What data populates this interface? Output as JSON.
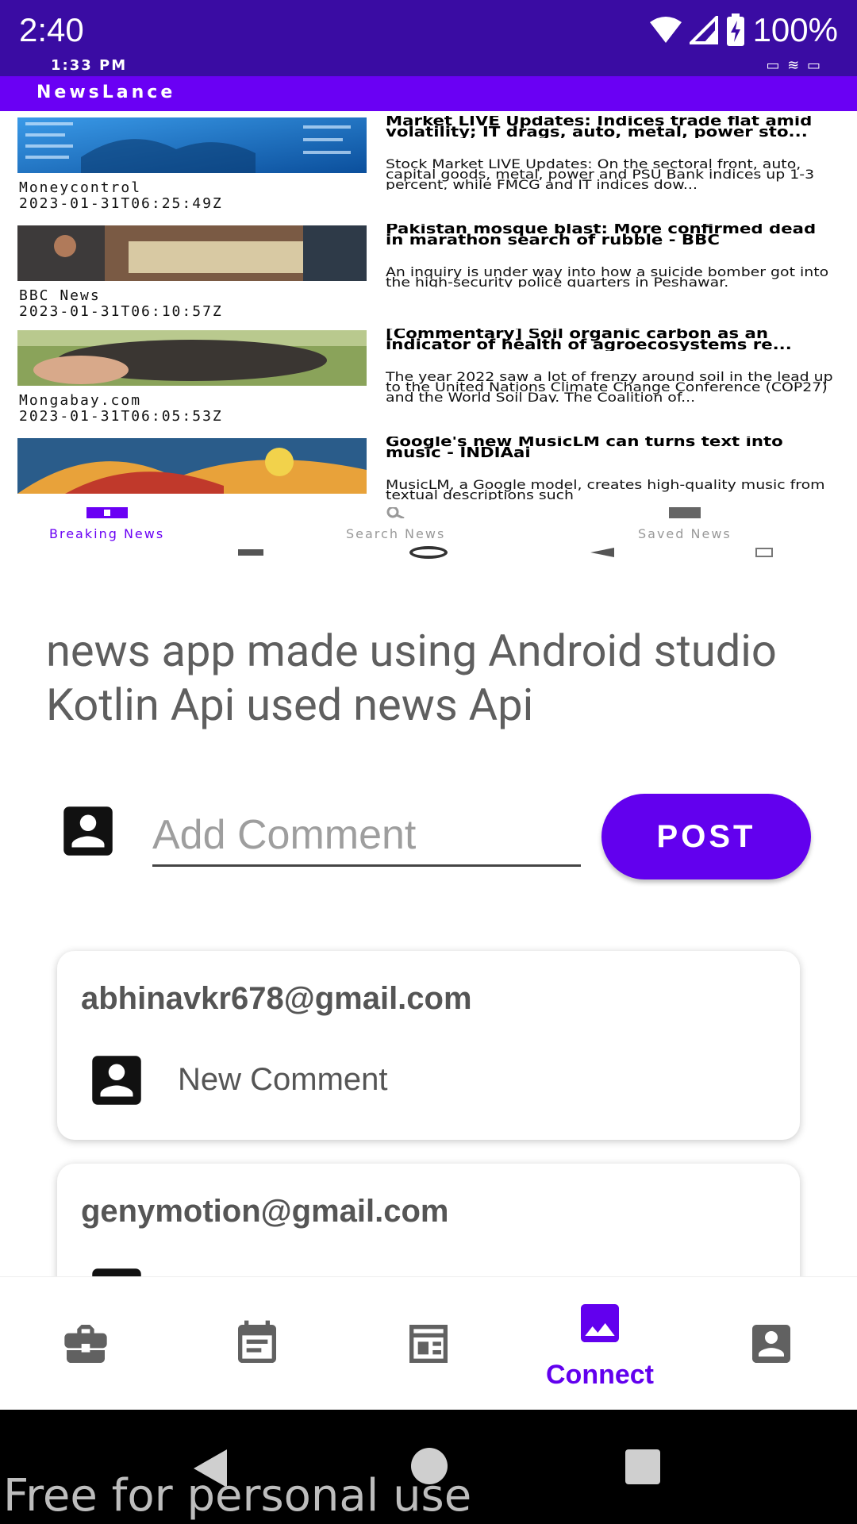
{
  "status_bar": {
    "time": "2:40",
    "battery": "100%"
  },
  "embedded_screenshot": {
    "status_time": "1:33 PM",
    "app_title": "NewsLance",
    "articles": [
      {
        "source": "Moneycontrol",
        "date": "2023-01-31T06:25:49Z",
        "headline": "Market LIVE Updates: Indices trade flat amid volatility; IT drags, auto, metal, power sto...",
        "description": "Stock Market LIVE Updates: On the sectoral front, auto, capital goods, metal, power and PSU Bank indices up 1-3 percent, while FMCG and IT indices dow..."
      },
      {
        "source": "BBC News",
        "date": "2023-01-31T06:10:57Z",
        "headline": "Pakistan mosque blast: More confirmed dead in marathon search of rubble - BBC",
        "description": "An inquiry is under way into how a suicide bomber got into the high-security police quarters in Peshawar."
      },
      {
        "source": "Mongabay.com",
        "date": "2023-01-31T06:05:53Z",
        "headline": "[Commentary] Soil organic carbon as an indicator of health of agroecosystems re...",
        "description": "The year 2022 saw a lot of frenzy around soil in the lead up to the United Nations Climate Change Conference (COP27) and the World Soil Day. The Coalition of..."
      },
      {
        "source": "",
        "date": "",
        "headline": "Google's new MusicLM can turns text into music - INDIAai",
        "description": "MusicLM, a Google model, creates high-quality music from textual descriptions such"
      }
    ],
    "tabs": [
      "Breaking News",
      "Search News",
      "Saved News"
    ]
  },
  "description": "news app made using Android studio Kotlin Api used news Api",
  "comment_input": {
    "placeholder": "Add Comment",
    "post_label": "POST"
  },
  "comments": [
    {
      "email": "abhinavkr678@gmail.com",
      "text": "New Comment"
    },
    {
      "email": "genymotion@gmail.com",
      "text": ""
    }
  ],
  "bottom_nav": {
    "items": [
      {
        "icon": "briefcase-icon",
        "label": ""
      },
      {
        "icon": "calendar-icon",
        "label": ""
      },
      {
        "icon": "dashboard-icon",
        "label": ""
      },
      {
        "icon": "image-icon",
        "label": "Connect"
      },
      {
        "icon": "account-box-icon",
        "label": ""
      }
    ],
    "active_index": 3,
    "active_color": "#6200ee",
    "inactive_color": "#616161"
  },
  "watermark": "Free for personal use"
}
